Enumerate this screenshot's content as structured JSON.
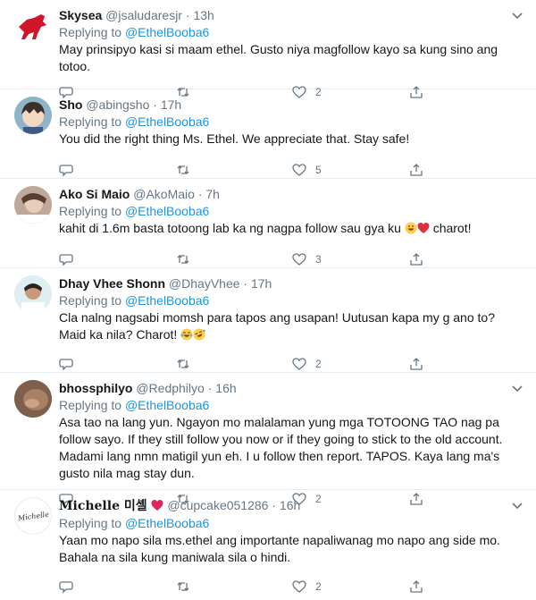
{
  "reply_prefix": "Replying to",
  "tweets": [
    {
      "name": "Skysea",
      "handle": "@jsaludaresjr",
      "time": "13h",
      "reply_to": "@EthelBooba6",
      "text": "May prinsipyo kasi si maam ethel. Gusto niya magfollow kayo sa kung sino ang totoo.",
      "likes": "2",
      "retweets": "",
      "replies": ""
    },
    {
      "name": "Sho",
      "handle": "@abingsho",
      "time": "17h",
      "reply_to": "@EthelBooba6",
      "text": "You did the right thing Ms. Ethel. We appreciate that. Stay safe!",
      "likes": "5",
      "retweets": "",
      "replies": ""
    },
    {
      "name": "Ako Si Maio",
      "handle": "@AkoMaio",
      "time": "7h",
      "reply_to": "@EthelBooba6",
      "text": "kahit di 1.6m basta totoong lab ka ng nagpa follow sau gya ku ",
      "text_after": " charot!",
      "likes": "3",
      "retweets": "",
      "replies": ""
    },
    {
      "name": "Dhay Vhee Shonn",
      "handle": "@DhayVhee",
      "time": "17h",
      "reply_to": "@EthelBooba6",
      "text": "Cla nalng nagsabi momsh para tapos ang usapan! Uutusan kapa my g ano to? Maid ka nila? Charot! ",
      "likes": "2",
      "retweets": "",
      "replies": ""
    },
    {
      "name": "bhossphilyo",
      "handle": "@Redphilyo",
      "time": "16h",
      "reply_to": "@EthelBooba6",
      "text": "Asa tao na lang yun. Ngayon mo malalaman yung mga TOTOONG TAO nag pa follow sayo. If they still follow you now or if they going to stick to the old account. Madami lang nmn matigil yun eh. I u follow then report. TAPOS. Kaya lang ma's gusto nila mag stay dun.",
      "likes": "2",
      "retweets": "",
      "replies": ""
    },
    {
      "name": "Michelle 미셸",
      "handle": "@cupcake051286",
      "time": "16h",
      "reply_to": "@EthelBooba6",
      "text": "Yaan mo napo sila ms.ethel ang importante napaliwanag mo napo ang side mo. Bahala na sila kung maniwala sila o hindi.",
      "likes": "2",
      "retweets": "",
      "replies": "",
      "avatar_text": "Michelle"
    }
  ],
  "colors": {
    "link": "#1b95e0",
    "muted": "#657786",
    "text": "#14171a",
    "divider": "#e6ecf0"
  },
  "icons": [
    "reply-icon",
    "retweet-icon",
    "like-icon",
    "share-icon",
    "chevron-down-icon",
    "avatar"
  ]
}
